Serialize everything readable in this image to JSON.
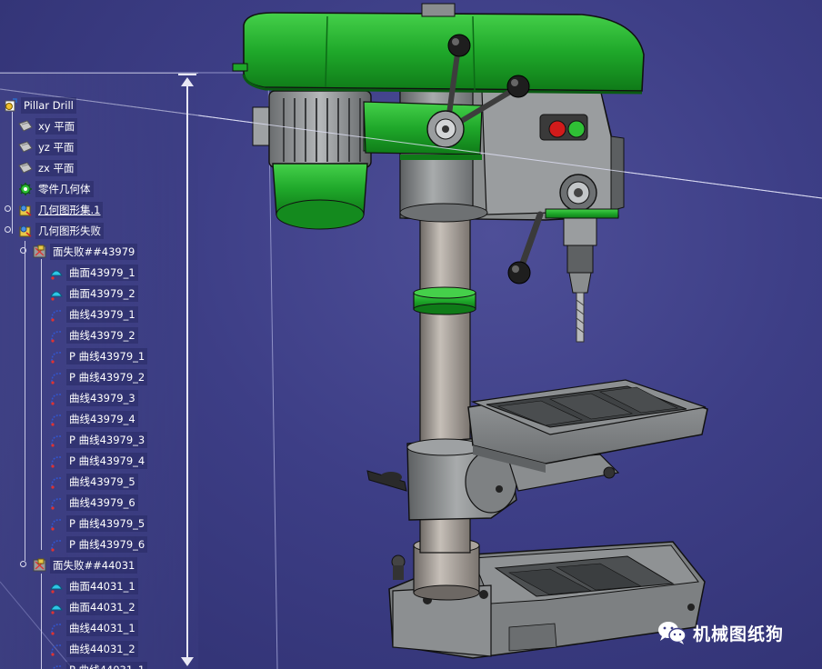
{
  "tree": {
    "root_label": "Pillar Drill",
    "items": [
      {
        "label": "xy 平面",
        "icon": "plane-icon"
      },
      {
        "label": "yz 平面",
        "icon": "plane-icon"
      },
      {
        "label": "zx 平面",
        "icon": "plane-icon"
      },
      {
        "label": "零件几何体",
        "icon": "body-gear-icon"
      },
      {
        "label": "几何图形集.1",
        "icon": "geometric-set-icon"
      },
      {
        "label": "几何图形失败",
        "icon": "geometric-set-icon"
      },
      {
        "label": "面失败##43979",
        "icon": "failed-face-icon"
      },
      {
        "label": "曲面43979_1",
        "icon": "surface-icon"
      },
      {
        "label": "曲面43979_2",
        "icon": "surface-icon"
      },
      {
        "label": "曲线43979_1",
        "icon": "curve-icon"
      },
      {
        "label": "曲线43979_2",
        "icon": "curve-icon"
      },
      {
        "label": "P 曲线43979_1",
        "icon": "curve-icon"
      },
      {
        "label": "P 曲线43979_2",
        "icon": "curve-icon"
      },
      {
        "label": "曲线43979_3",
        "icon": "curve-icon"
      },
      {
        "label": "曲线43979_4",
        "icon": "curve-icon"
      },
      {
        "label": "P 曲线43979_3",
        "icon": "curve-icon"
      },
      {
        "label": "P 曲线43979_4",
        "icon": "curve-icon"
      },
      {
        "label": "曲线43979_5",
        "icon": "curve-icon"
      },
      {
        "label": "曲线43979_6",
        "icon": "curve-icon"
      },
      {
        "label": "P 曲线43979_5",
        "icon": "curve-icon"
      },
      {
        "label": "P 曲线43979_6",
        "icon": "curve-icon"
      },
      {
        "label": "面失败##44031",
        "icon": "failed-face-icon"
      },
      {
        "label": "曲面44031_1",
        "icon": "surface-icon"
      },
      {
        "label": "曲面44031_2",
        "icon": "surface-icon"
      },
      {
        "label": "曲线44031_1",
        "icon": "curve-icon"
      },
      {
        "label": "曲线44031_2",
        "icon": "curve-icon"
      },
      {
        "label": "P 曲线44031_1",
        "icon": "curve-icon"
      }
    ]
  },
  "watermark": {
    "text": "机械图纸狗",
    "icon": "wechat-icon"
  },
  "colors": {
    "background": "#3d3e86",
    "machine_green": "#1fa82a",
    "machine_gray": "#8a8d8e",
    "button_red": "#d11b1b",
    "button_green": "#2fbf35"
  }
}
